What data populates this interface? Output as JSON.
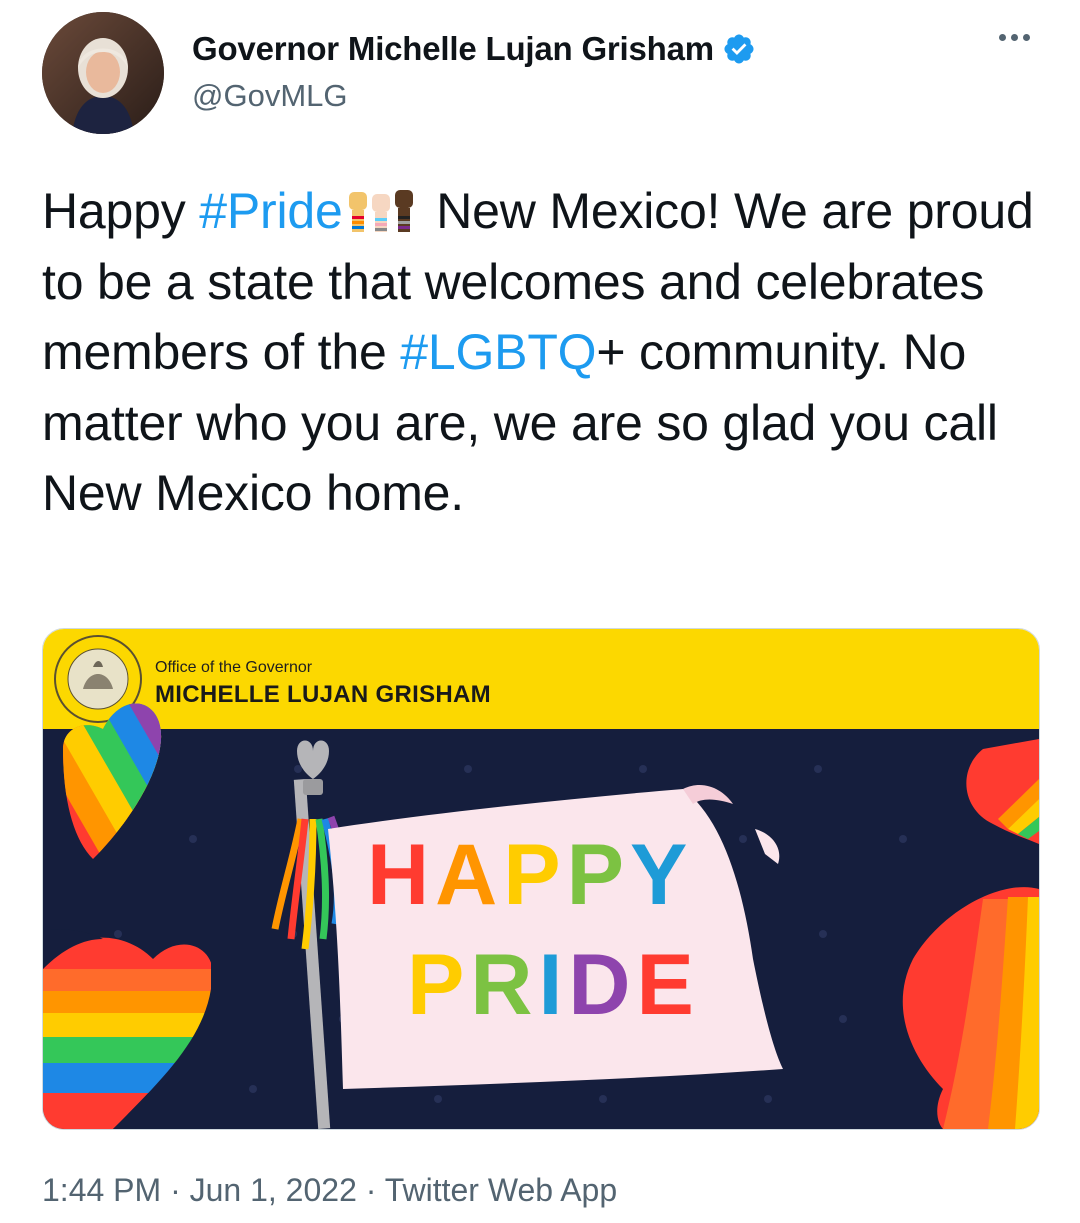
{
  "author": {
    "display_name": "Governor Michelle Lujan Grisham",
    "handle": "@GovMLG",
    "verified": true
  },
  "tweet": {
    "text_part1": "Happy ",
    "hashtag1": "#Pride",
    "emoji": "raised-fists-emoji",
    "text_part2": " New Mexico! We are proud to be a state that welcomes and celebrates members of the ",
    "hashtag2": "#LGBTQ",
    "text_part3": "+ community. No matter who you are, we are so glad you call New Mexico home."
  },
  "card": {
    "office_line": "Office of the Governor",
    "governor_name": "MICHELLE LUJAN GRISHAM",
    "banner_line1": "HAPPY",
    "banner_line2": "PRIDE",
    "seal_text": "GREAT SEAL OF THE STATE OF NEW MEXICO 1912",
    "colors": {
      "header_yellow": "#fcd800",
      "background_navy": "#151e3d",
      "banner_pink": "#fbe6ec"
    }
  },
  "meta": {
    "time": "1:44 PM",
    "separator": "·",
    "date": "Jun 1, 2022",
    "source": "Twitter Web App"
  },
  "colors": {
    "link_blue": "#1d9bf0",
    "secondary_text": "#536471"
  }
}
